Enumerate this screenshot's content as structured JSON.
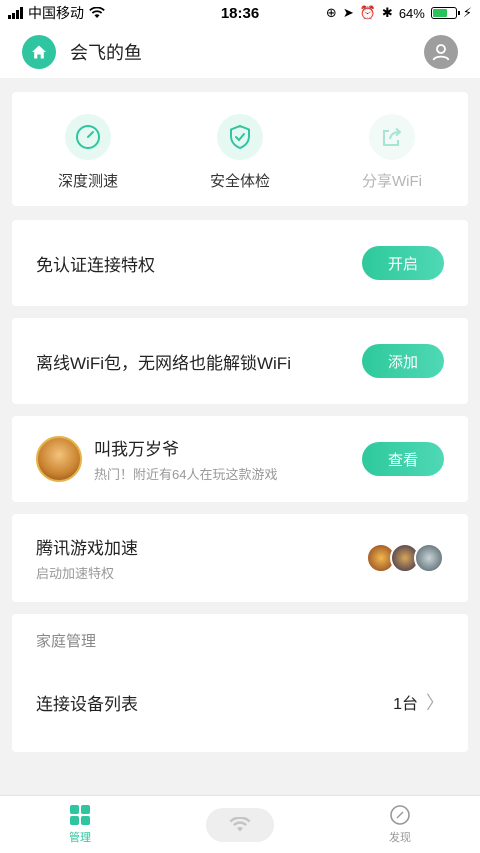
{
  "status": {
    "carrier": "中国移动",
    "time": "18:36",
    "battery_pct": "64%",
    "battery_level": 0.64
  },
  "header": {
    "username": "会飞的鱼",
    "home_icon": "home-icon",
    "avatar_icon": "user-icon"
  },
  "tools": [
    {
      "label": "深度测速",
      "icon": "speedometer-icon"
    },
    {
      "label": "安全体检",
      "icon": "shield-check-icon"
    },
    {
      "label": "分享WiFi",
      "icon": "share-icon"
    }
  ],
  "privilege": {
    "title": "免认证连接特权",
    "button": "开启"
  },
  "offline": {
    "title": "离线WiFi包，无网络也能解锁WiFi",
    "button": "添加"
  },
  "game": {
    "title": "叫我万岁爷",
    "subtitle": "热门！附近有64人在玩这款游戏",
    "button": "查看"
  },
  "accel": {
    "title": "腾讯游戏加速",
    "subtitle": "启动加速特权"
  },
  "family": {
    "title": "家庭管理",
    "device_list": "连接设备列表",
    "device_count": "1台"
  },
  "tabbar": {
    "manage": "管理",
    "discover": "发现"
  },
  "colors": {
    "accent": "#2ec5a0"
  }
}
